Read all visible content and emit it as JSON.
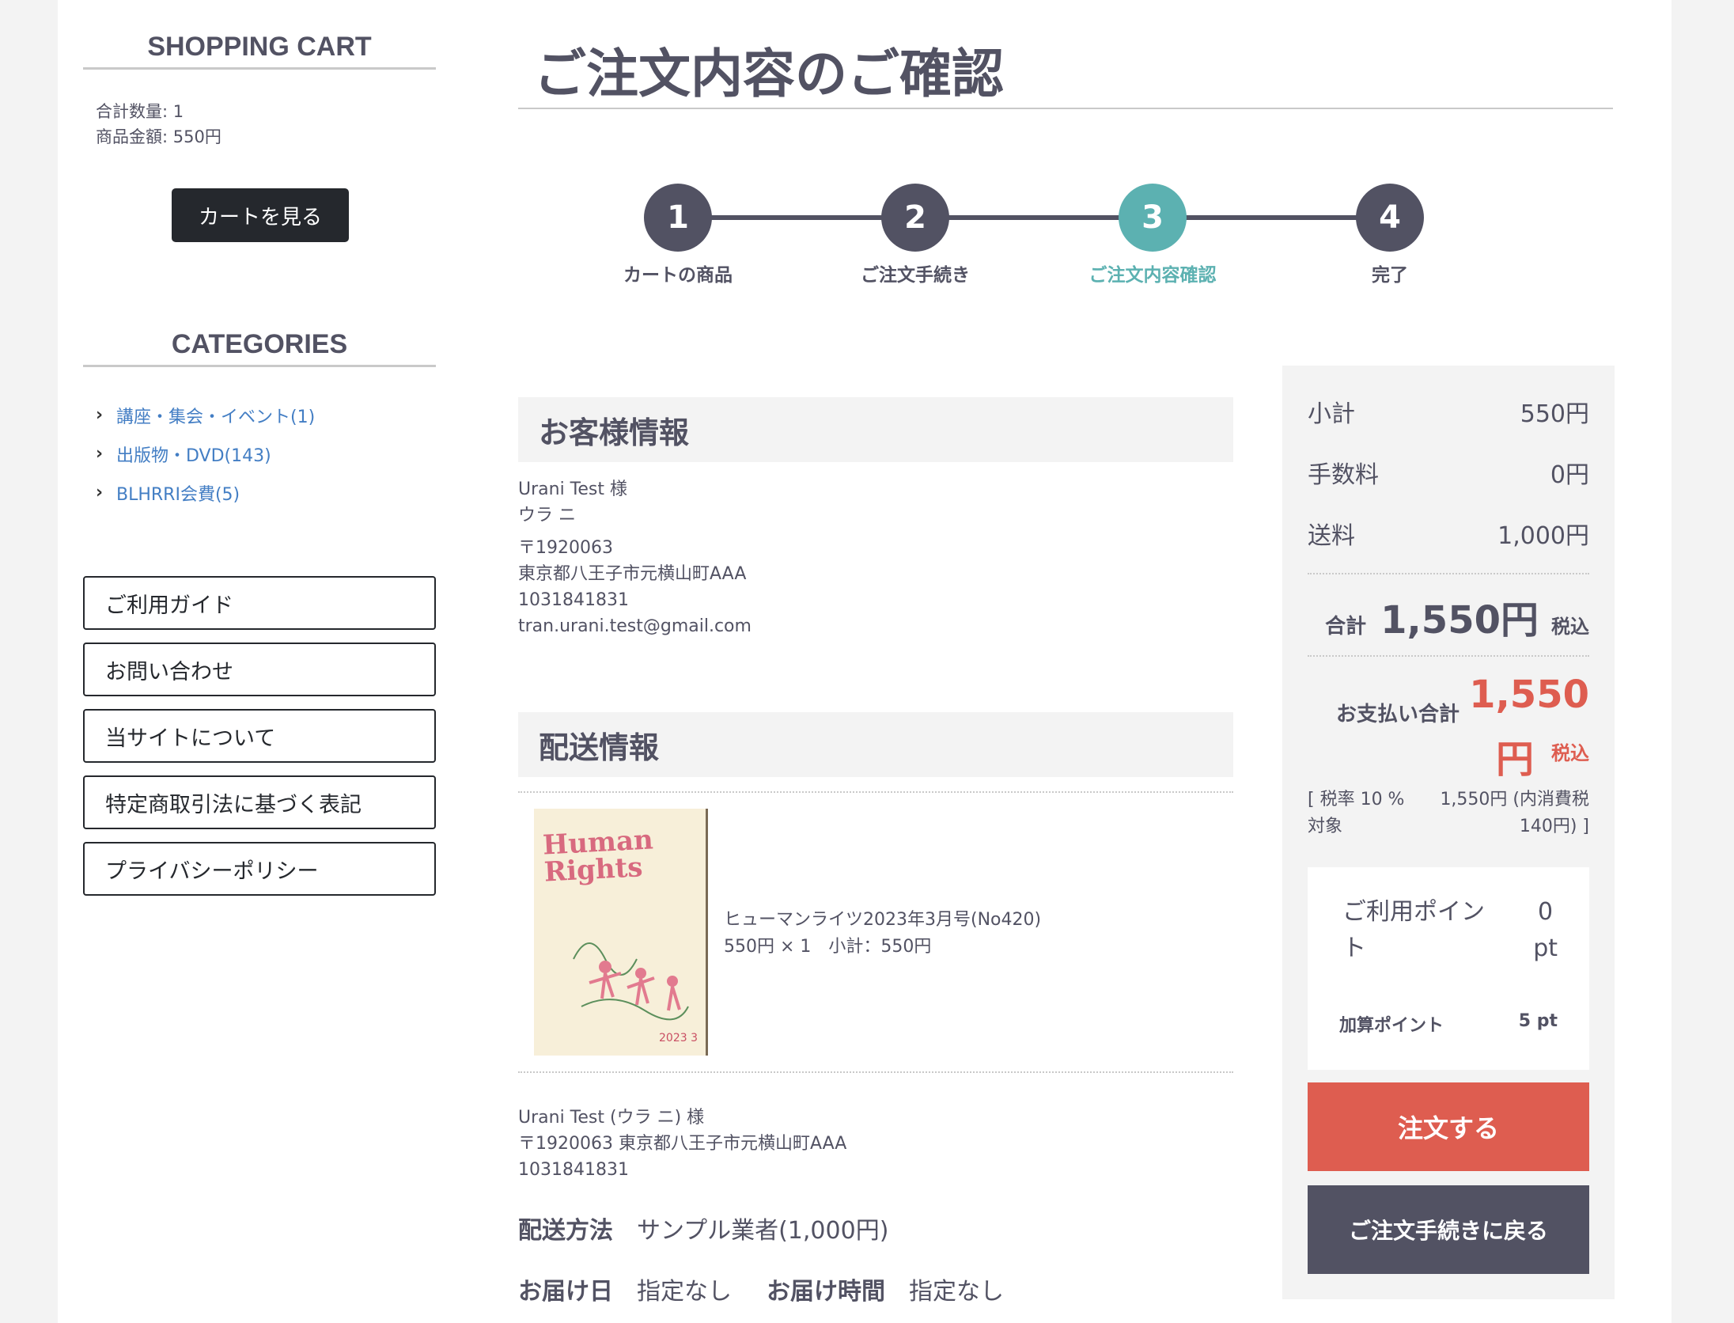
{
  "sidebar": {
    "cart_heading": "SHOPPING CART",
    "cart_qty": "合計数量: 1",
    "cart_amount": "商品金額: 550円",
    "cart_button": "カートを見る",
    "categories_heading": "CATEGORIES",
    "categories": [
      {
        "label": "講座・集会・イベント(1)"
      },
      {
        "label": "出版物・DVD(143)"
      },
      {
        "label": "BLHRRI会費(5)"
      }
    ],
    "links": [
      {
        "label": "ご利用ガイド"
      },
      {
        "label": "お問い合わせ"
      },
      {
        "label": "当サイトについて"
      },
      {
        "label": "特定商取引法に基づく表記"
      },
      {
        "label": "プライバシーポリシー"
      }
    ]
  },
  "main": {
    "title": "ご注文内容のご確認",
    "steps": [
      {
        "num": "1",
        "label": "カートの商品"
      },
      {
        "num": "2",
        "label": "ご注文手続き"
      },
      {
        "num": "3",
        "label": "ご注文内容確認"
      },
      {
        "num": "4",
        "label": "完了"
      }
    ],
    "active_step": 3,
    "customer_heading": "お客様情報",
    "customer": {
      "name": "Urani Test 様",
      "kana": "ウラ ニ",
      "postal": "〒1920063",
      "address": "東京都八王子市元横山町AAA",
      "phone": "1031841831",
      "email": "tran.urani.test@gmail.com"
    },
    "shipping_heading": "配送情報",
    "product": {
      "cover_title_1": "Human",
      "cover_title_2": "Rights",
      "cover_year": "2023 3",
      "name": "ヒューマンライツ2023年3月号(No420)",
      "price_line": "550円 × 1　小計：550円"
    },
    "ship_to": {
      "name": "Urani Test (ウラ ニ) 様",
      "address": "〒1920063 東京都八王子市元横山町AAA",
      "phone": "1031841831"
    },
    "method_label": "配送方法",
    "method_value": "サンプル業者(1,000円)",
    "date_label": "お届け日",
    "date_value": "指定なし",
    "time_label": "お届け時間",
    "time_value": "指定なし"
  },
  "summary": {
    "subtotal_label": "小計",
    "subtotal_value": "550円",
    "fee_label": "手数料",
    "fee_value": "0円",
    "shipping_label": "送料",
    "shipping_value": "1,000円",
    "total_label": "合計",
    "total_value": "1,550円",
    "total_tax": "税込",
    "pay_label": "お支払い合計",
    "pay_value": "1,550",
    "pay_yen": "円",
    "pay_tax": "税込",
    "tax_note_left": "[ 税率 10 % 対象",
    "tax_note_right_1": "1,550円 (内消費税",
    "tax_note_right_2": "140円) ]",
    "use_points_label": "ご利用ポイント",
    "use_points_value": "0",
    "use_points_unit": "pt",
    "add_points_label": "加算ポイント",
    "add_points_value": "5 pt",
    "order_button": "注文する",
    "back_button": "ご注文手続きに戻る",
    "colors": {
      "accent": "#de5d50",
      "active_step": "#5cb1b1",
      "dark": "#525263"
    }
  }
}
